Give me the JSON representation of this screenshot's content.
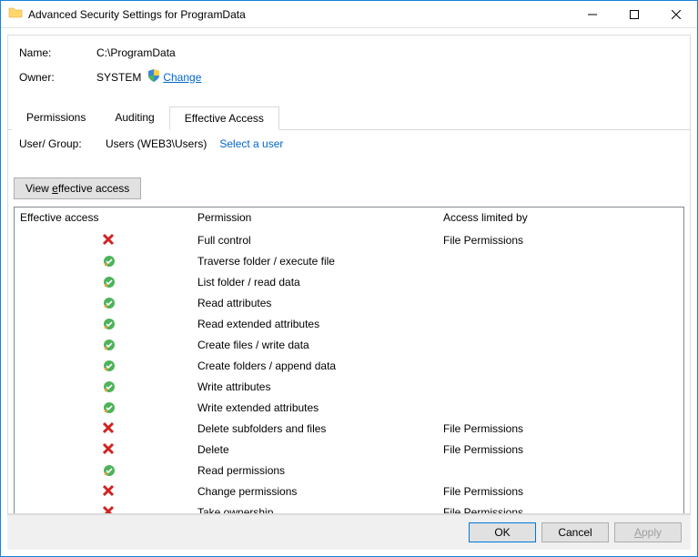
{
  "window": {
    "title": "Advanced Security Settings for ProgramData"
  },
  "header": {
    "name_label": "Name:",
    "name_value": "C:\\ProgramData",
    "owner_label": "Owner:",
    "owner_value": "SYSTEM",
    "change_link": "Change"
  },
  "tabs": {
    "permissions": "Permissions",
    "auditing": "Auditing",
    "effective": "Effective Access"
  },
  "usergroup": {
    "label": "User/ Group:",
    "value": "Users (WEB3\\Users)",
    "select_link": "Select a user"
  },
  "view_button": {
    "prefix": "View ",
    "underline": "e",
    "suffix": "ffective access"
  },
  "columns": {
    "a": "Effective access",
    "b": "Permission",
    "c": "Access limited by"
  },
  "rows": [
    {
      "status": "deny",
      "perm": "Full control",
      "limit": "File Permissions"
    },
    {
      "status": "allow",
      "perm": "Traverse folder / execute file",
      "limit": ""
    },
    {
      "status": "allow",
      "perm": "List folder / read data",
      "limit": ""
    },
    {
      "status": "allow",
      "perm": "Read attributes",
      "limit": ""
    },
    {
      "status": "allow",
      "perm": "Read extended attributes",
      "limit": ""
    },
    {
      "status": "allow",
      "perm": "Create files / write data",
      "limit": ""
    },
    {
      "status": "allow",
      "perm": "Create folders / append data",
      "limit": ""
    },
    {
      "status": "allow",
      "perm": "Write attributes",
      "limit": ""
    },
    {
      "status": "allow",
      "perm": "Write extended attributes",
      "limit": ""
    },
    {
      "status": "deny",
      "perm": "Delete subfolders and files",
      "limit": "File Permissions"
    },
    {
      "status": "deny",
      "perm": "Delete",
      "limit": "File Permissions"
    },
    {
      "status": "allow",
      "perm": "Read permissions",
      "limit": ""
    },
    {
      "status": "deny",
      "perm": "Change permissions",
      "limit": "File Permissions"
    },
    {
      "status": "deny",
      "perm": "Take ownership",
      "limit": "File Permissions"
    }
  ],
  "buttons": {
    "ok": "OK",
    "cancel": "Cancel",
    "apply_u": "A",
    "apply_rest": "pply"
  }
}
